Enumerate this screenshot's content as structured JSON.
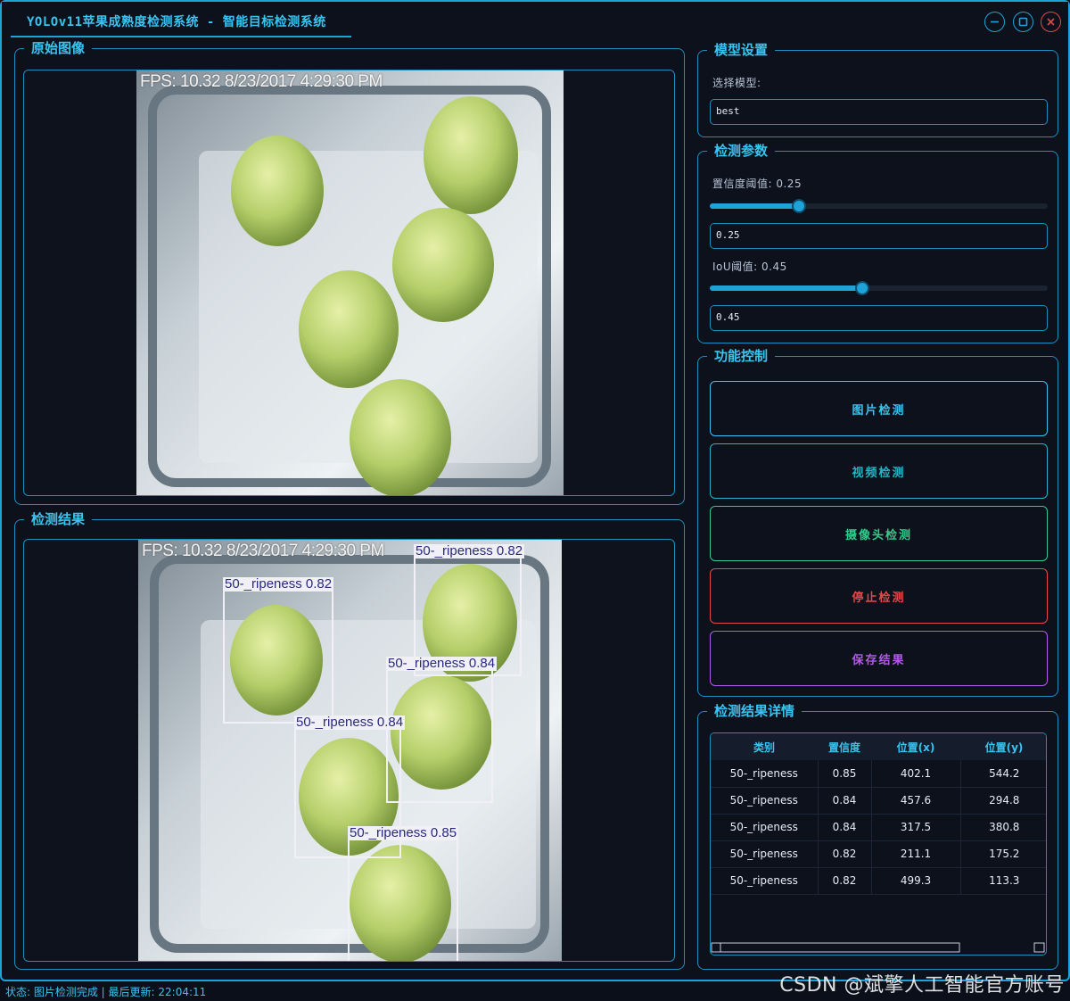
{
  "window": {
    "title": "YOLOv11苹果成熟度检测系统 - 智能目标检测系统"
  },
  "panels": {
    "original_title": "原始图像",
    "result_title": "检测结果"
  },
  "image_overlay": {
    "fps_text": "FPS: 10.32 8/23/2017 4:29:30 PM"
  },
  "detections": [
    {
      "label": "50-_ripeness 0.82"
    },
    {
      "label": "50-_ripeness 0.82"
    },
    {
      "label": "50-_ripeness 0.84"
    },
    {
      "label": "50-_ripeness 0.84"
    },
    {
      "label": "50-_ripeness 0.85"
    }
  ],
  "model_settings": {
    "title": "模型设置",
    "select_label": "选择模型:",
    "selected_model": "best"
  },
  "detection_params": {
    "title": "检测参数",
    "confidence_label": "置信度阈值: 0.25",
    "confidence_value": "0.25",
    "confidence_fraction": 0.25,
    "iou_label": "IoU阈值: 0.45",
    "iou_value": "0.45",
    "iou_fraction": 0.45
  },
  "function_control": {
    "title": "功能控制",
    "buttons": [
      {
        "label": "图片检测",
        "color": "#38c4f0"
      },
      {
        "label": "视频检测",
        "color": "#26b4c8"
      },
      {
        "label": "摄像头检测",
        "color": "#2ecf8c"
      },
      {
        "label": "停止检测",
        "color": "#e54848"
      },
      {
        "label": "保存结果",
        "color": "#b05ae8"
      }
    ]
  },
  "results_table": {
    "title": "检测结果详情",
    "headers": [
      "类别",
      "置信度",
      "位置(x)",
      "位置(y)"
    ],
    "rows": [
      [
        "50-_ripeness",
        "0.85",
        "402.1",
        "544.2"
      ],
      [
        "50-_ripeness",
        "0.84",
        "457.6",
        "294.8"
      ],
      [
        "50-_ripeness",
        "0.84",
        "317.5",
        "380.8"
      ],
      [
        "50-_ripeness",
        "0.82",
        "211.1",
        "175.2"
      ],
      [
        "50-_ripeness",
        "0.82",
        "499.3",
        "113.3"
      ]
    ]
  },
  "status_bar": {
    "text": "状态: 图片检测完成 | 最后更新: 22:04:11"
  },
  "watermark": "CSDN @斌擎人工智能官方账号",
  "colors": {
    "accent": "#1ea3d8",
    "title_text": "#38c4f0",
    "background": "#0c111c"
  }
}
